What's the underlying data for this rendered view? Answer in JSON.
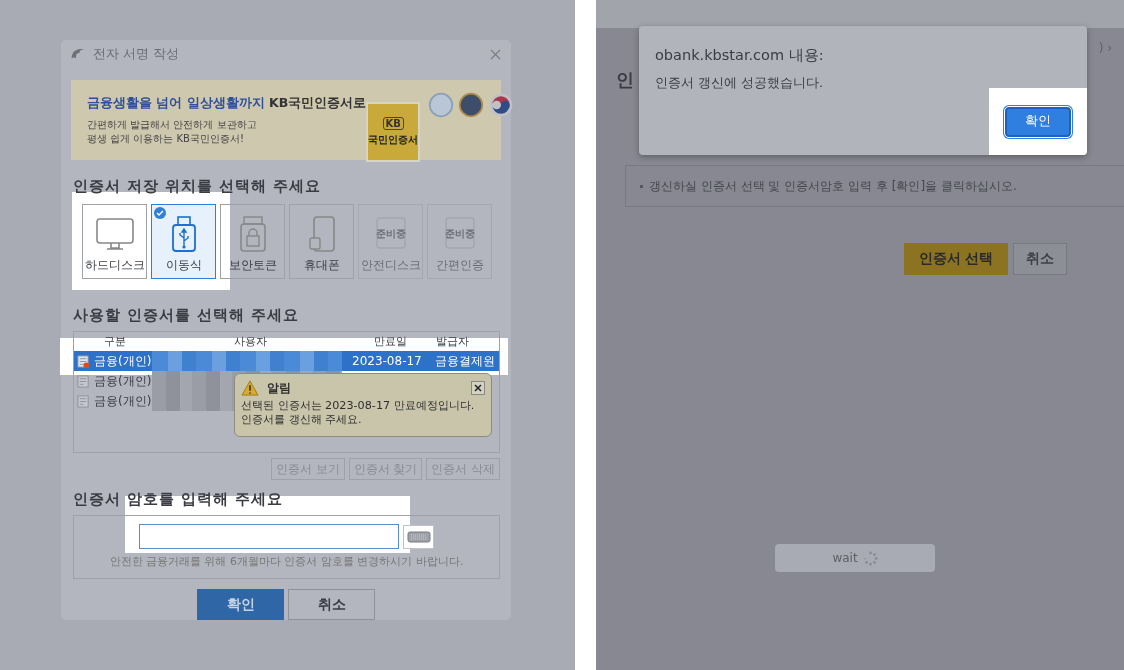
{
  "signing_dialog": {
    "title": "전자 서명 작성",
    "banner": {
      "headline_accent": "금융생활을 넘어 일상생활까지",
      "headline_rest": "KB국민인증서로",
      "lines": [
        "간편하게 발급해서 안전하게 보관하고",
        "평생 쉽게 이용하는 KB국민인증서!"
      ],
      "card_badge": "KB",
      "card_label": "국민인증서"
    },
    "storage_heading": "인증서 저장 위치를 선택해 주세요",
    "storage_options": [
      {
        "kind": "monitor",
        "label": "하드디스크",
        "selected": false,
        "disabled": false
      },
      {
        "kind": "usb",
        "label": "이동식",
        "selected": true,
        "disabled": false
      },
      {
        "kind": "lock",
        "label": "보안토큰",
        "selected": false,
        "disabled": false
      },
      {
        "kind": "phone",
        "label": "휴대폰",
        "selected": false,
        "disabled": false
      },
      {
        "kind": "disk",
        "label": "안전디스크",
        "badge": "준비중",
        "selected": false,
        "disabled": true
      },
      {
        "kind": "simple",
        "label": "간편인증",
        "badge": "준비중",
        "selected": false,
        "disabled": true
      }
    ],
    "cert_heading": "사용할 인증서를 선택해 주세요",
    "table": {
      "columns": [
        "구분",
        "사용자",
        "만료일",
        "발급자"
      ],
      "rows": [
        {
          "type": "금융(개인)",
          "expiry": "2023-08-17",
          "issuer": "금융결제원",
          "selected": true
        },
        {
          "type": "금융(개인)",
          "selected": false
        },
        {
          "type": "금융(개인)",
          "selected": false
        }
      ]
    },
    "notice": {
      "title": "알림",
      "lines": [
        "선택된 인증서는 2023-08-17 만료예정입니다.",
        "인증서를 갱신해 주세요."
      ]
    },
    "cert_buttons": [
      "인증서 보기",
      "인증서 찾기",
      "인증서 삭제"
    ],
    "password_heading": "인증서 암호를 입력해 주세요",
    "password_hint": "안전한 금융거래를 위해 6개월마다 인증서 암호를 변경하시기 바랍니다.",
    "actions": [
      {
        "label": "확인",
        "primary": true
      },
      {
        "label": "취소",
        "primary": false
      }
    ]
  },
  "renewal_page": {
    "breadcrumb_fragment": ") ›",
    "heading_fragment": "인",
    "info_note": "갱신하실 인증서 선택 및 인증서암호 입력 후 [확인]을 클릭하십시오.",
    "actions": [
      {
        "label": "인증서 선택",
        "primary": true
      },
      {
        "label": "취소",
        "primary": false
      }
    ],
    "wait_label": "wait",
    "alert": {
      "origin": "obank.kbstar.com 내용:",
      "message": "인증서 갱신에 성공했습니다.",
      "button": "확인"
    }
  }
}
